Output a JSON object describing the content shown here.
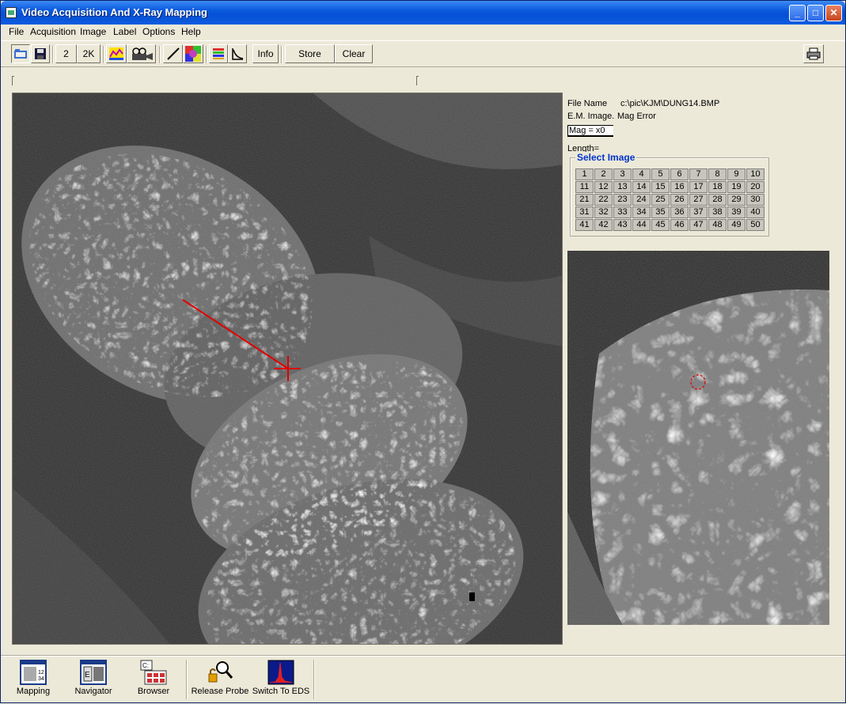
{
  "window": {
    "title": "Video Acquisition And X-Ray Mapping"
  },
  "menu": [
    "File",
    "Acquisition",
    "Image",
    "Label",
    "Options",
    "Help"
  ],
  "toolbar": {
    "btn_2": "2",
    "btn_2k": "2K",
    "info": "Info",
    "store": "Store",
    "clear": "Clear"
  },
  "info": {
    "file_name_label": "File Name",
    "file_name_value": "c:\\pic\\KJM\\DUNG14.BMP",
    "em_image": "E.M. Image.",
    "mag_error": "Mag Error",
    "mag": "Mag = x0",
    "length": "Length="
  },
  "select_image": {
    "title": "Select Image",
    "numbers": [
      "1",
      "2",
      "3",
      "4",
      "5",
      "6",
      "7",
      "8",
      "9",
      "10",
      "11",
      "12",
      "13",
      "14",
      "15",
      "16",
      "17",
      "18",
      "19",
      "20",
      "21",
      "22",
      "23",
      "24",
      "25",
      "26",
      "27",
      "28",
      "29",
      "30",
      "31",
      "32",
      "33",
      "34",
      "35",
      "36",
      "37",
      "38",
      "39",
      "40",
      "41",
      "42",
      "43",
      "44",
      "45",
      "46",
      "47",
      "48",
      "49",
      "50"
    ]
  },
  "taskbar": {
    "mapping": "Mapping",
    "navigator": "Navigator",
    "browser": "Browser",
    "release_probe": "Release Probe",
    "switch_eds": "Switch To EDS"
  },
  "colors": {
    "title_blue": "#0a5ade",
    "accent_red": "#e00000",
    "legend_blue": "#0033cc"
  }
}
